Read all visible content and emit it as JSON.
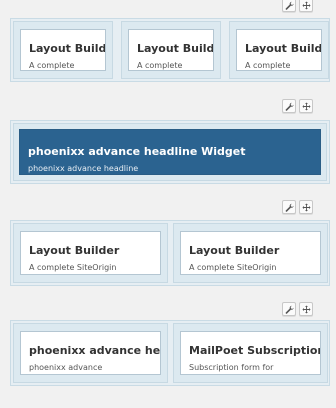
{
  "rows": [
    {
      "widgets": [
        {
          "title": "Layout Build",
          "desc": "A complete"
        },
        {
          "title": "Layout Build",
          "desc": "A complete"
        },
        {
          "title": "Layout Build",
          "desc": "A complete"
        }
      ]
    },
    {
      "widgets": [
        {
          "title": "phoenixx advance headline Widget",
          "desc": "phoenixx advance headline"
        }
      ]
    },
    {
      "widgets": [
        {
          "title": "Layout Builder",
          "desc": "A complete SiteOrigin"
        },
        {
          "title": "Layout Builder",
          "desc": "A complete SiteOrigin"
        }
      ]
    },
    {
      "widgets": [
        {
          "title": "phoenixx advance he",
          "desc": "phoenixx advance"
        },
        {
          "title": "MailPoet Subscription",
          "desc": "Subscription form for"
        }
      ]
    }
  ],
  "icons": {
    "edit": "wrench-icon",
    "move": "move-arrows-icon"
  },
  "colors": {
    "selected_widget": "#2b6390",
    "row_bg": "#e6eef3",
    "cell_bg": "#dce9f0"
  }
}
